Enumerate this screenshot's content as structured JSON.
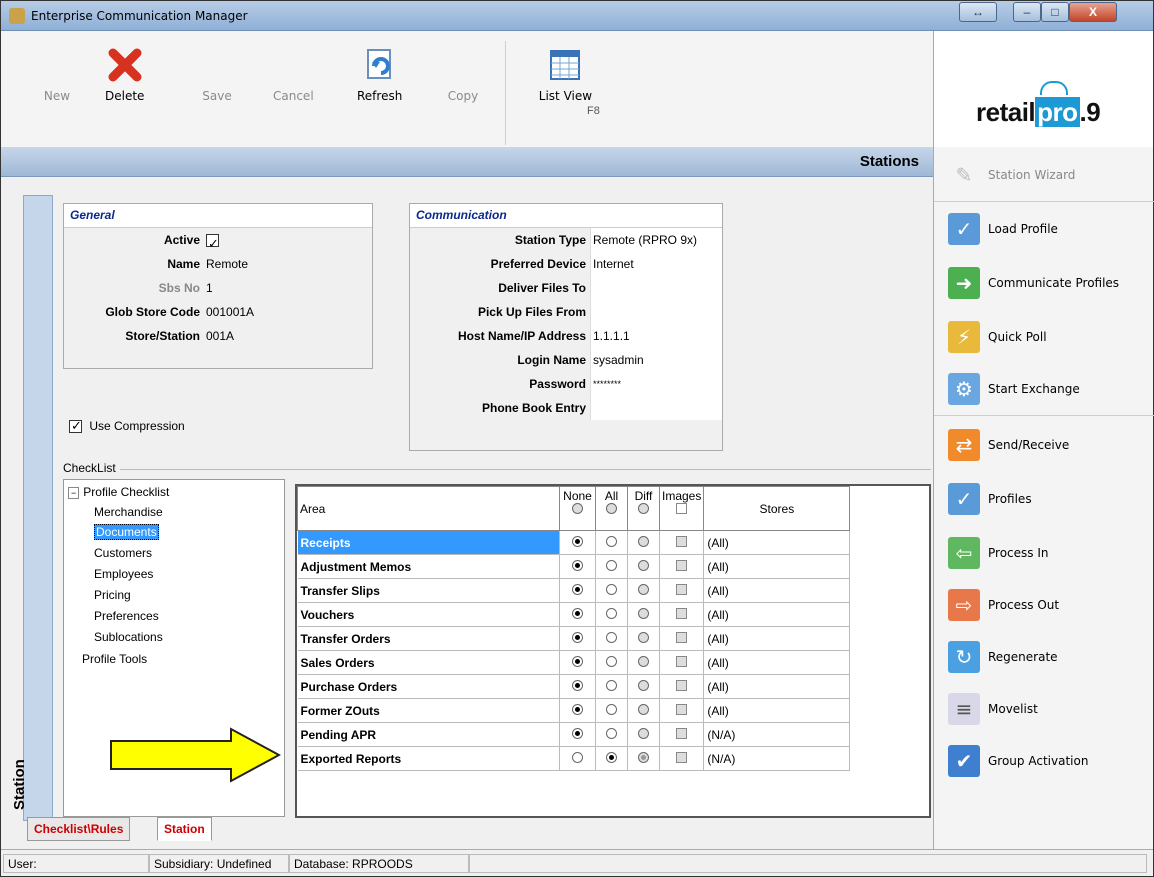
{
  "window": {
    "title": "Enterprise Communication Manager",
    "minimize": "–",
    "maximize": "□",
    "close": "X",
    "restore": "↔"
  },
  "toolbar": {
    "new": "New",
    "delete": "Delete",
    "save": "Save",
    "cancel": "Cancel",
    "refresh": "Refresh",
    "copy": "Copy",
    "list_view": "List View",
    "list_view_hint": "F8"
  },
  "logo": {
    "retail": "retail",
    "pro": "pro",
    "nine": ".9"
  },
  "banner": {
    "title": "Stations"
  },
  "vertical_tab": "Station",
  "general": {
    "header": "General",
    "active_label": "Active",
    "name_label": "Name",
    "name_value": "Remote",
    "sbs_label": "Sbs No",
    "sbs_value": "1",
    "glob_label": "Glob Store Code",
    "glob_value": "001001A",
    "store_label": "Store/Station",
    "store_value": "001A"
  },
  "use_compression": "Use Compression",
  "communication": {
    "header": "Communication",
    "rows": [
      {
        "label": "Station Type",
        "value": "Remote (RPRO 9x)"
      },
      {
        "label": "Preferred Device",
        "value": "Internet"
      },
      {
        "label": "Deliver Files To",
        "value": ""
      },
      {
        "label": "Pick Up Files From",
        "value": ""
      },
      {
        "label": "Host Name/IP Address",
        "value": "1.1.1.1"
      },
      {
        "label": "Login Name",
        "value": "sysadmin"
      },
      {
        "label": "Password",
        "value": "********"
      },
      {
        "label": "Phone Book Entry",
        "value": ""
      }
    ]
  },
  "checklist": {
    "label": "CheckList",
    "tree": {
      "root": "Profile Checklist",
      "children": [
        "Merchandise",
        "Documents",
        "Customers",
        "Employees",
        "Pricing",
        "Preferences",
        "Sublocations"
      ],
      "tools": "Profile Tools"
    }
  },
  "grid": {
    "headers": {
      "area": "Area",
      "none": "None",
      "all": "All",
      "diff": "Diff",
      "images": "Images",
      "stores": "Stores"
    },
    "rows": [
      {
        "area": "Receipts",
        "sel": "none",
        "stores": "(All)"
      },
      {
        "area": "Adjustment Memos",
        "sel": "none",
        "stores": "(All)"
      },
      {
        "area": "Transfer Slips",
        "sel": "none",
        "stores": "(All)"
      },
      {
        "area": "Vouchers",
        "sel": "none",
        "stores": "(All)"
      },
      {
        "area": "Transfer Orders",
        "sel": "none",
        "stores": "(All)"
      },
      {
        "area": "Sales Orders",
        "sel": "none",
        "stores": "(All)"
      },
      {
        "area": "Purchase Orders",
        "sel": "none",
        "stores": "(All)"
      },
      {
        "area": "Former ZOuts",
        "sel": "none",
        "stores": "(All)"
      },
      {
        "area": "Pending APR",
        "sel": "none",
        "stores": "(N/A)"
      },
      {
        "area": "Exported Reports",
        "sel": "all",
        "stores": "(N/A)"
      }
    ]
  },
  "bottom_tabs": {
    "rules": "Checklist\\Rules",
    "station": "Station"
  },
  "side": {
    "wizard": "Station Wizard",
    "load_profile": "Load Profile",
    "communicate_profiles": "Communicate Profiles",
    "quick_poll": "Quick Poll",
    "start_exchange": "Start Exchange",
    "send_receive": "Send/Receive",
    "profiles": "Profiles",
    "process_in": "Process In",
    "process_out": "Process Out",
    "regenerate": "Regenerate",
    "movelist": "Movelist",
    "group_activation": "Group Activation"
  },
  "status": {
    "user": "User:",
    "subsidiary": "Subsidiary: Undefined",
    "database": "Database: RPROODS"
  },
  "colors": {
    "selection": "#3399ff",
    "tab_red": "#cc0000",
    "arrow_fill": "#ffff00"
  }
}
